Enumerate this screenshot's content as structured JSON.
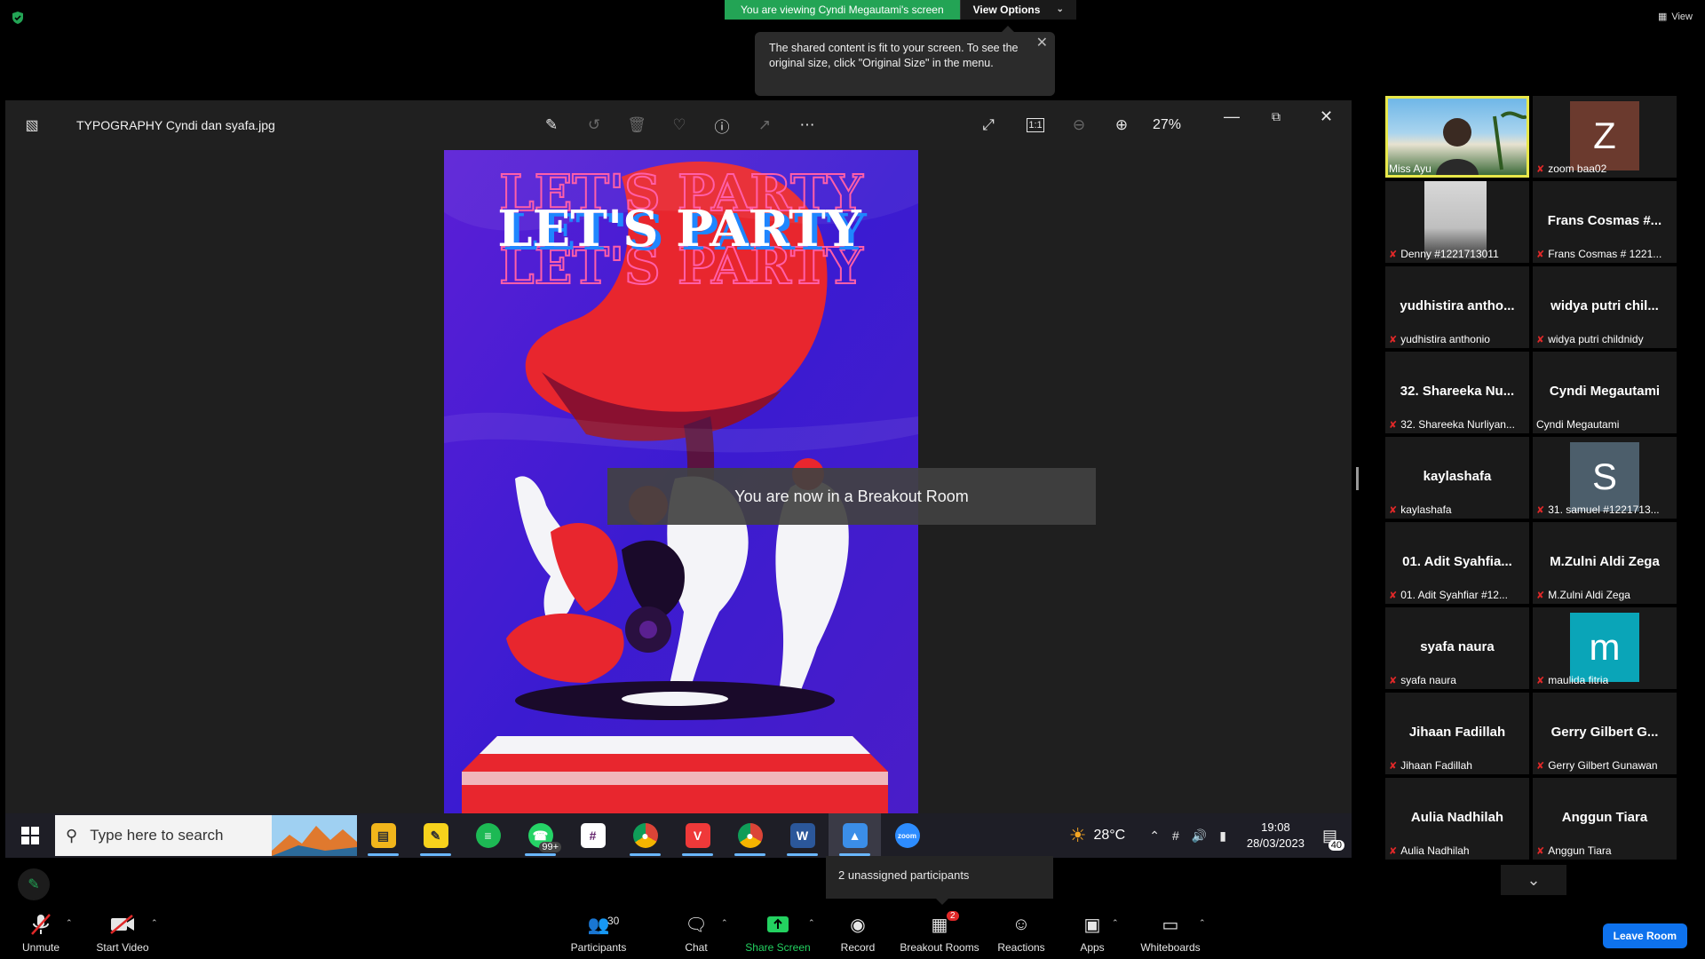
{
  "banner": {
    "viewing_text": "You are viewing Cyndi Megautami's screen",
    "view_options": "View Options",
    "top_right_view": "View"
  },
  "tooltip": {
    "text": "The shared content is fit to your screen. To see the original size, click \"Original Size\" in the menu."
  },
  "photos_app": {
    "file_name": "TYPOGRAPHY Cyndi dan syafa.jpg",
    "zoom": "27%",
    "poster_title": "LET'S PARTY"
  },
  "toast": {
    "breakout": "You are now in a Breakout Room"
  },
  "taskbar": {
    "search_placeholder": "Type here to search",
    "whatsapp_badge": "99+",
    "temperature": "28°C",
    "time": "19:08",
    "date": "28/03/2023",
    "notifications": "40"
  },
  "gallery": [
    {
      "name": "",
      "sub": "Miss Ayu",
      "muted": false,
      "avatar": "",
      "video": true,
      "speaking": true
    },
    {
      "name": "",
      "sub": "zoom baa02",
      "muted": true,
      "avatar": "Z",
      "avatar_color": "#6b3a2e"
    },
    {
      "name": "",
      "sub": "Denny #1221713011",
      "muted": true,
      "avatar": "",
      "video": true
    },
    {
      "name": "Frans Cosmas #...",
      "sub": "Frans Cosmas # 1221...",
      "muted": true
    },
    {
      "name": "yudhistira antho...",
      "sub": "yudhistira anthonio",
      "muted": true
    },
    {
      "name": "widya putri chil...",
      "sub": "widya putri childnidy",
      "muted": true
    },
    {
      "name": "32. Shareeka Nu...",
      "sub": "32. Shareeka Nurliyan...",
      "muted": true
    },
    {
      "name": "Cyndi Megautami",
      "sub": "Cyndi Megautami",
      "muted": false
    },
    {
      "name": "kaylashafa",
      "sub": "kaylashafa",
      "muted": true
    },
    {
      "name": "",
      "sub": "31. samuel #1221713...",
      "muted": true,
      "avatar": "S",
      "avatar_color": "#4c5e6b"
    },
    {
      "name": "01. Adit Syahfia...",
      "sub": "01. Adit Syahfiar #12...",
      "muted": true
    },
    {
      "name": "M.Zulni Aldi Zega",
      "sub": "M.Zulni Aldi Zega",
      "muted": true
    },
    {
      "name": "syafa naura",
      "sub": "syafa naura",
      "muted": true
    },
    {
      "name": "",
      "sub": "maulida fitria",
      "muted": true,
      "avatar": "m",
      "avatar_color": "#0aa5b8"
    },
    {
      "name": "Jihaan Fadillah",
      "sub": "Jihaan Fadillah",
      "muted": true
    },
    {
      "name": "Gerry Gilbert G...",
      "sub": "Gerry Gilbert Gunawan",
      "muted": true
    },
    {
      "name": "Aulia Nadhilah",
      "sub": "Aulia Nadhilah",
      "muted": true
    },
    {
      "name": "Anggun Tiara",
      "sub": "Anggun Tiara",
      "muted": true
    }
  ],
  "popup": {
    "unassigned": "2 unassigned participants"
  },
  "controls": {
    "unmute": "Unmute",
    "start_video": "Start Video",
    "participants": "Participants",
    "participants_count": "30",
    "chat": "Chat",
    "share_screen": "Share Screen",
    "record": "Record",
    "breakout_rooms": "Breakout Rooms",
    "breakout_badge": "2",
    "reactions": "Reactions",
    "apps": "Apps",
    "whiteboards": "Whiteboards",
    "leave_room": "Leave Room"
  },
  "colors": {
    "green": "#23a455",
    "leave_blue": "#0e72ed",
    "muted_red": "#e02828",
    "speaking_outline": "#e8e84a"
  }
}
